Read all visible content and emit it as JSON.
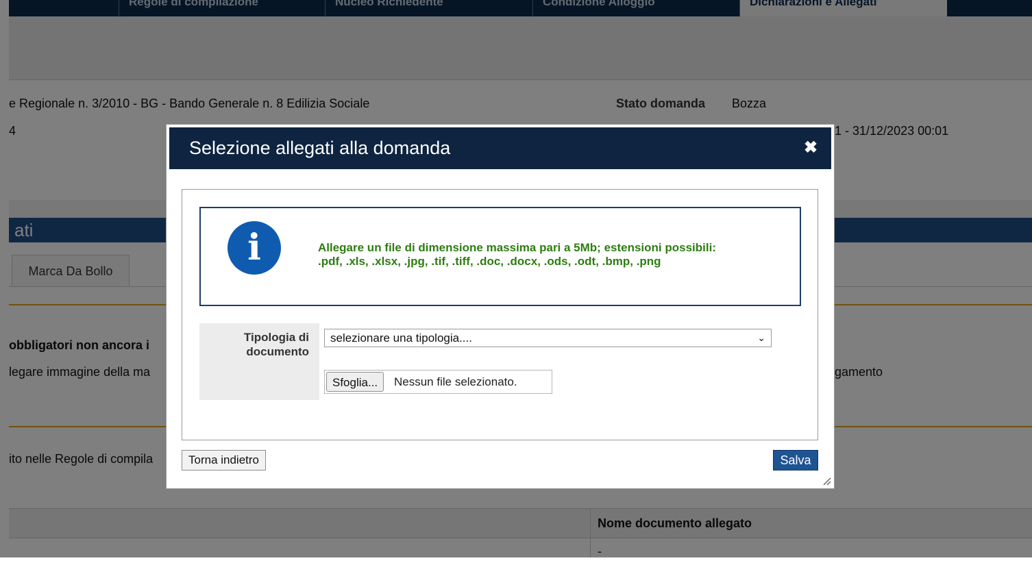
{
  "background": {
    "top_tabs": [
      "Regole di compilazione",
      "Nucleo Richiedente",
      "Condizione Alloggio",
      "Dichiarazioni e Allegati"
    ],
    "bando": "e Regionale n. 3/2010 - BG - Bando Generale n. 8 Edilizia Sociale",
    "stato_label": "Stato domanda",
    "stato_value": "Bozza",
    "id_fragment": "4",
    "period": "1 - 31/12/2023 00:01",
    "section_title": "ati",
    "tab_marca": "Marca Da Bollo",
    "warning_bold": "obbligatori non ancora i",
    "warning_text": "legare immagine della ma",
    "payment_fragment": "gamento",
    "rules_text": "ito nelle Regole di compila",
    "table_header_name": "Nome documento allegato",
    "table_cell_dash": "-"
  },
  "modal": {
    "title": "Selezione allegati alla domanda",
    "close_symbol": "✖",
    "info_icon_glyph": "i",
    "info_line1": "Allegare un file di dimensione massima pari a 5Mb; estensioni possibili:",
    "info_line2": ".pdf, .xls, .xlsx, .jpg, .tif, .tiff, .doc, .docx, .ods, .odt, .bmp, .png",
    "tipologia_label_1": "Tipologia di",
    "tipologia_label_2": "documento",
    "select_value": "selezionare una tipologia....",
    "browse_button": "Sfoglia...",
    "file_status": "Nessun file selezionato.",
    "back_button": "Torna indietro",
    "save_button": "Salva"
  },
  "colors": {
    "modal_header": "#0e2440",
    "info_text": "#2e7d12",
    "info_icon": "#0f5bb0",
    "save_button": "#1f5493"
  }
}
